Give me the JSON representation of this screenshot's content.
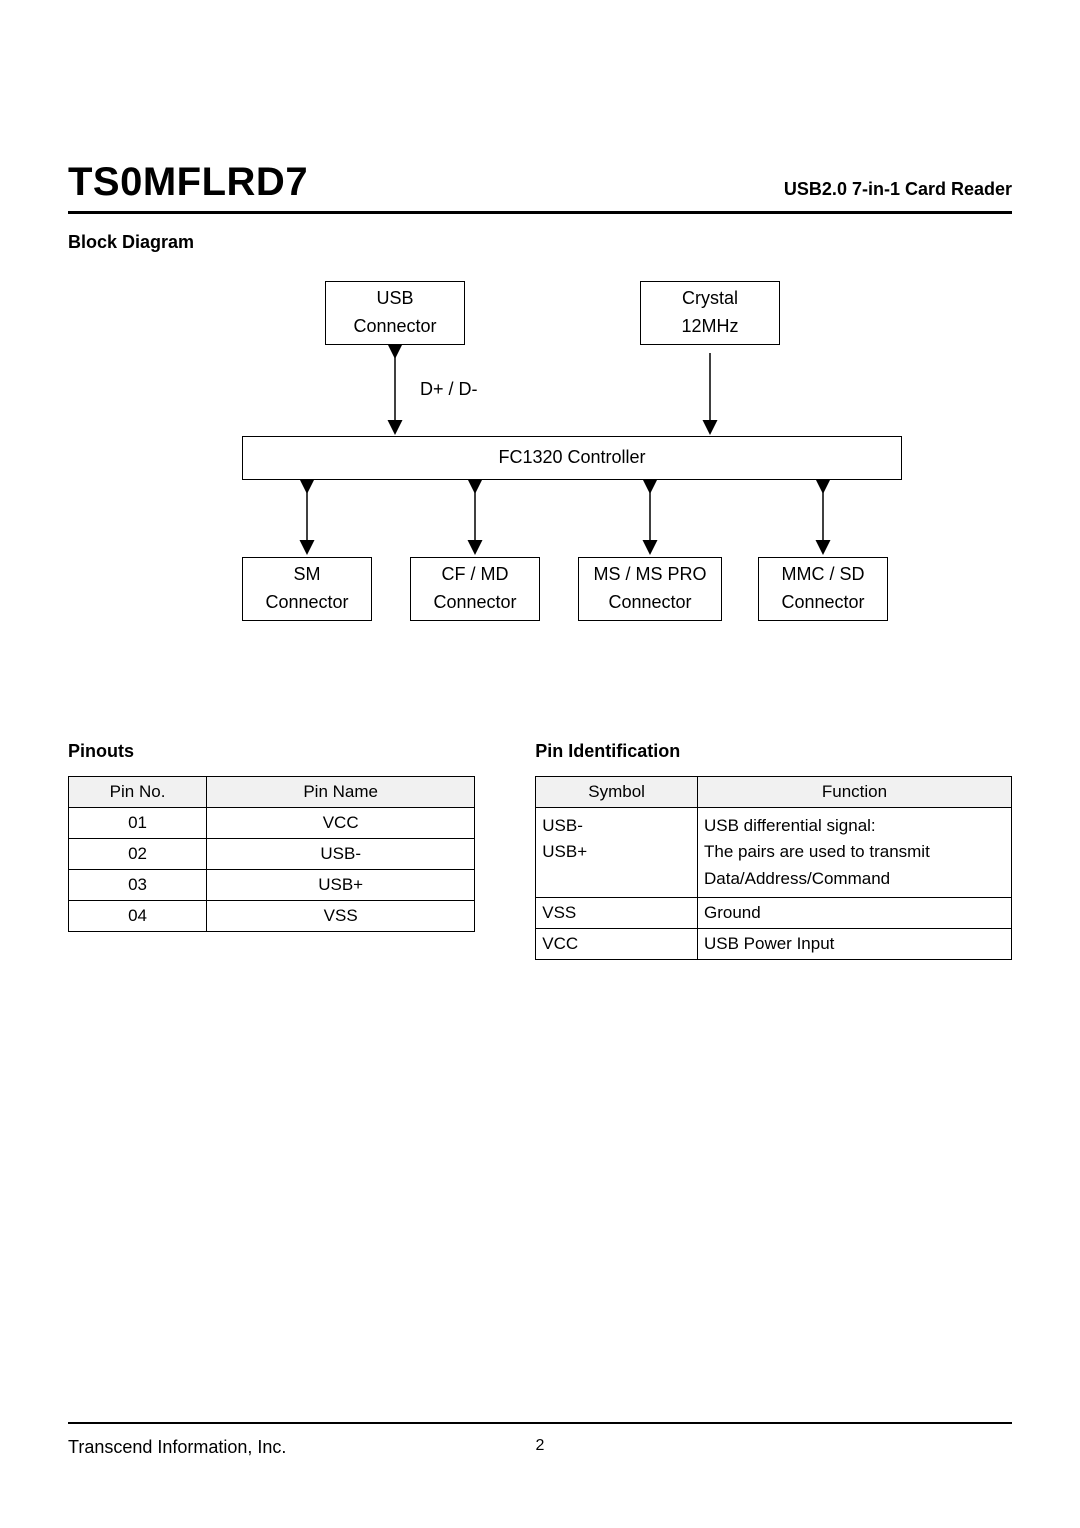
{
  "header": {
    "product_code": "TS0MFLRD7",
    "product_desc": "USB2.0 7-in-1 Card Reader"
  },
  "sections": {
    "block_diagram": "Block Diagram",
    "pinouts": "Pinouts",
    "pin_identification": "Pin Identification"
  },
  "diagram": {
    "usb_connector_l1": "USB",
    "usb_connector_l2": "Connector",
    "crystal_l1": "Crystal",
    "crystal_l2": "12MHz",
    "d_label": "D+ / D-",
    "controller": "FC1320 Controller",
    "sm_l1": "SM",
    "sm_l2": "Connector",
    "cf_l1": "CF / MD",
    "cf_l2": "Connector",
    "ms_l1": "MS / MS PRO",
    "ms_l2": "Connector",
    "mmc_l1": "MMC / SD",
    "mmc_l2": "Connector"
  },
  "pinouts_table": {
    "headers": {
      "pin_no": "Pin No.",
      "pin_name": "Pin Name"
    },
    "rows": [
      {
        "no": "01",
        "name": "VCC"
      },
      {
        "no": "02",
        "name": "USB-"
      },
      {
        "no": "03",
        "name": "USB+"
      },
      {
        "no": "04",
        "name": "VSS"
      }
    ]
  },
  "pinid_table": {
    "headers": {
      "symbol": "Symbol",
      "function": "Function"
    },
    "rows": [
      {
        "symbol_l1": "USB-",
        "symbol_l2": "USB+",
        "func_l1": "USB differential signal:",
        "func_l2": "The pairs are used to transmit",
        "func_l3": "Data/Address/Command"
      },
      {
        "symbol": "VSS",
        "func": "Ground"
      },
      {
        "symbol": "VCC",
        "func": "USB Power Input"
      }
    ]
  },
  "footer": {
    "company": "Transcend Information, Inc.",
    "page": "2"
  }
}
